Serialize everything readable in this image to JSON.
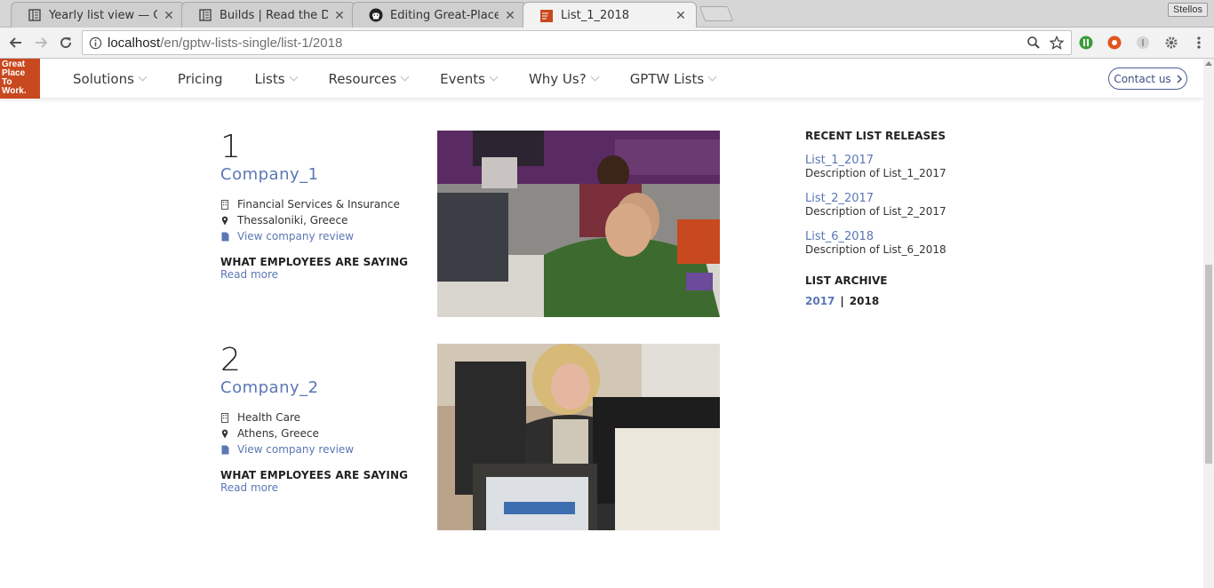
{
  "browser": {
    "tabs": [
      {
        "title": "Yearly list view — Great",
        "favicon": "docs-icon"
      },
      {
        "title": "Builds | Read the Docs",
        "favicon": "docs-icon"
      },
      {
        "title": "Editing Great-Place-to-W",
        "favicon": "github-icon"
      },
      {
        "title": "List_1_2018",
        "favicon": "gptw-icon"
      }
    ],
    "profile": "Stellos",
    "url_host": "localhost",
    "url_path": "/en/gptw-lists-single/list-1/2018"
  },
  "site": {
    "logo_lines": [
      "Great",
      "Place",
      "To",
      "Work."
    ],
    "nav": [
      "Solutions",
      "Pricing",
      "Lists",
      "Resources",
      "Events",
      "Why Us?",
      "GPTW Lists"
    ],
    "contact_label": "Contact us",
    "brand_color": "#c8491f",
    "link_color": "#5b77b5"
  },
  "companies": [
    {
      "rank": "1",
      "name": "Company_1",
      "industry": "Financial Services & Insurance",
      "location": "Thessaloniki, Greece",
      "review_link": "View company review",
      "saying_heading": "WHAT EMPLOYEES ARE SAYING",
      "read_more": "Read more"
    },
    {
      "rank": "2",
      "name": "Company_2",
      "industry": "Health Care",
      "location": "Athens, Greece",
      "review_link": "View company review",
      "saying_heading": "WHAT EMPLOYEES ARE SAYING",
      "read_more": "Read more"
    }
  ],
  "sidebar": {
    "recent_heading": "RECENT LIST RELEASES",
    "releases": [
      {
        "title": "List_1_2017",
        "description": "Description of List_1_2017"
      },
      {
        "title": "List_2_2017",
        "description": "Description of List_2_2017"
      },
      {
        "title": "List_6_2018",
        "description": "Description of List_6_2018"
      }
    ],
    "archive_heading": "LIST ARCHIVE",
    "archive_years": [
      "2017",
      "2018"
    ],
    "archive_separator": "|"
  }
}
